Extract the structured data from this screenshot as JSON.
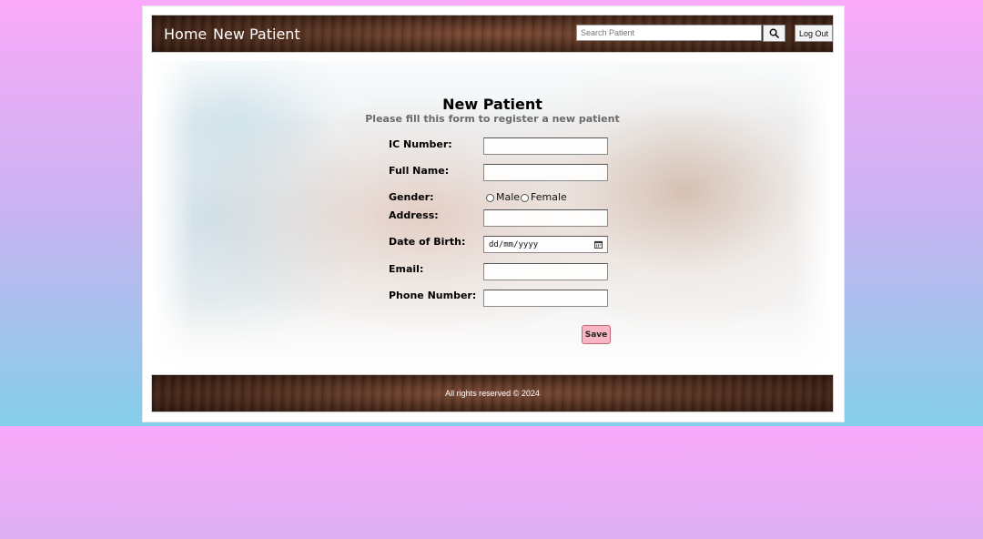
{
  "header": {
    "nav": [
      {
        "label": "Home"
      },
      {
        "label": "New Patient"
      }
    ],
    "search": {
      "placeholder": "Search Patient",
      "button_icon": "search-icon"
    },
    "logout_label": "Log Out"
  },
  "form": {
    "title": "New Patient",
    "subtitle": "Please fill this form to register a new patient",
    "fields": {
      "ic_number": {
        "label": "IC Number:",
        "value": ""
      },
      "full_name": {
        "label": "Full Name:",
        "value": ""
      },
      "gender": {
        "label": "Gender:",
        "options": [
          "Male",
          "Female"
        ],
        "selected": ""
      },
      "address": {
        "label": "Address:",
        "value": ""
      },
      "date_of_birth": {
        "label": "Date of Birth:",
        "placeholder": "dd/mm/yyyy",
        "icon": "calendar-icon"
      },
      "email": {
        "label": "Email:",
        "value": ""
      },
      "phone_number": {
        "label": "Phone Number:",
        "value": ""
      }
    },
    "save_label": "Save"
  },
  "footer": {
    "text": "All rights reserved © 2024"
  },
  "colors": {
    "save_button": "#f7b6c2",
    "background_top": "#fbaafa",
    "background_bottom": "#84cfea",
    "header_wood": "#4a2a1b"
  }
}
